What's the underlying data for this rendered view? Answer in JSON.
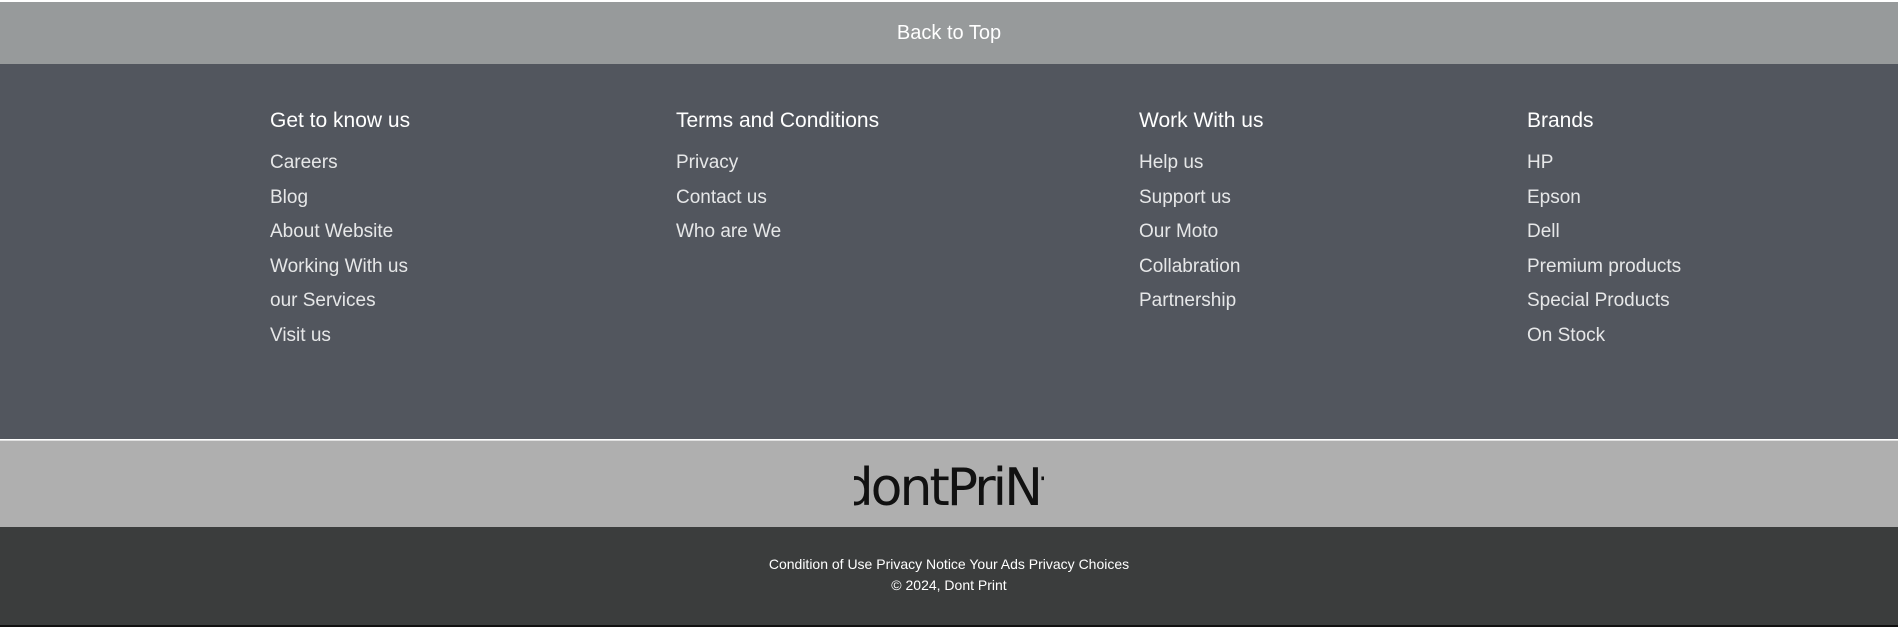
{
  "back_to_top": {
    "label": "Back to Top"
  },
  "columns": [
    {
      "heading": "Get to know us",
      "items": [
        "Careers",
        "Blog",
        "About Website",
        "Working With us",
        "our Services",
        "Visit us"
      ]
    },
    {
      "heading": "Terms and Conditions",
      "items": [
        "Privacy",
        "Contact us",
        "Who are We"
      ]
    },
    {
      "heading": "Work With us",
      "items": [
        "Help us",
        "Support us",
        "Our Moto",
        "Collabration",
        "Partnership"
      ]
    },
    {
      "heading": "Brands",
      "items": [
        "HP",
        "Epson",
        "Dell",
        "Premium products",
        "Special Products",
        "On Stock"
      ]
    }
  ],
  "logo": {
    "text": "dontPriNt"
  },
  "bottom_bar": {
    "links": [
      "Condition of Use",
      "Privacy Notice",
      "Your Ads Privacy Choices"
    ],
    "copyright": "© 2024, Dont Print"
  },
  "colors": {
    "back_to_top_bg": "#979a9b",
    "links_bg": "#52565e",
    "logo_band_bg": "#afafaf",
    "bottom_bar_bg": "#3b3d3d"
  }
}
